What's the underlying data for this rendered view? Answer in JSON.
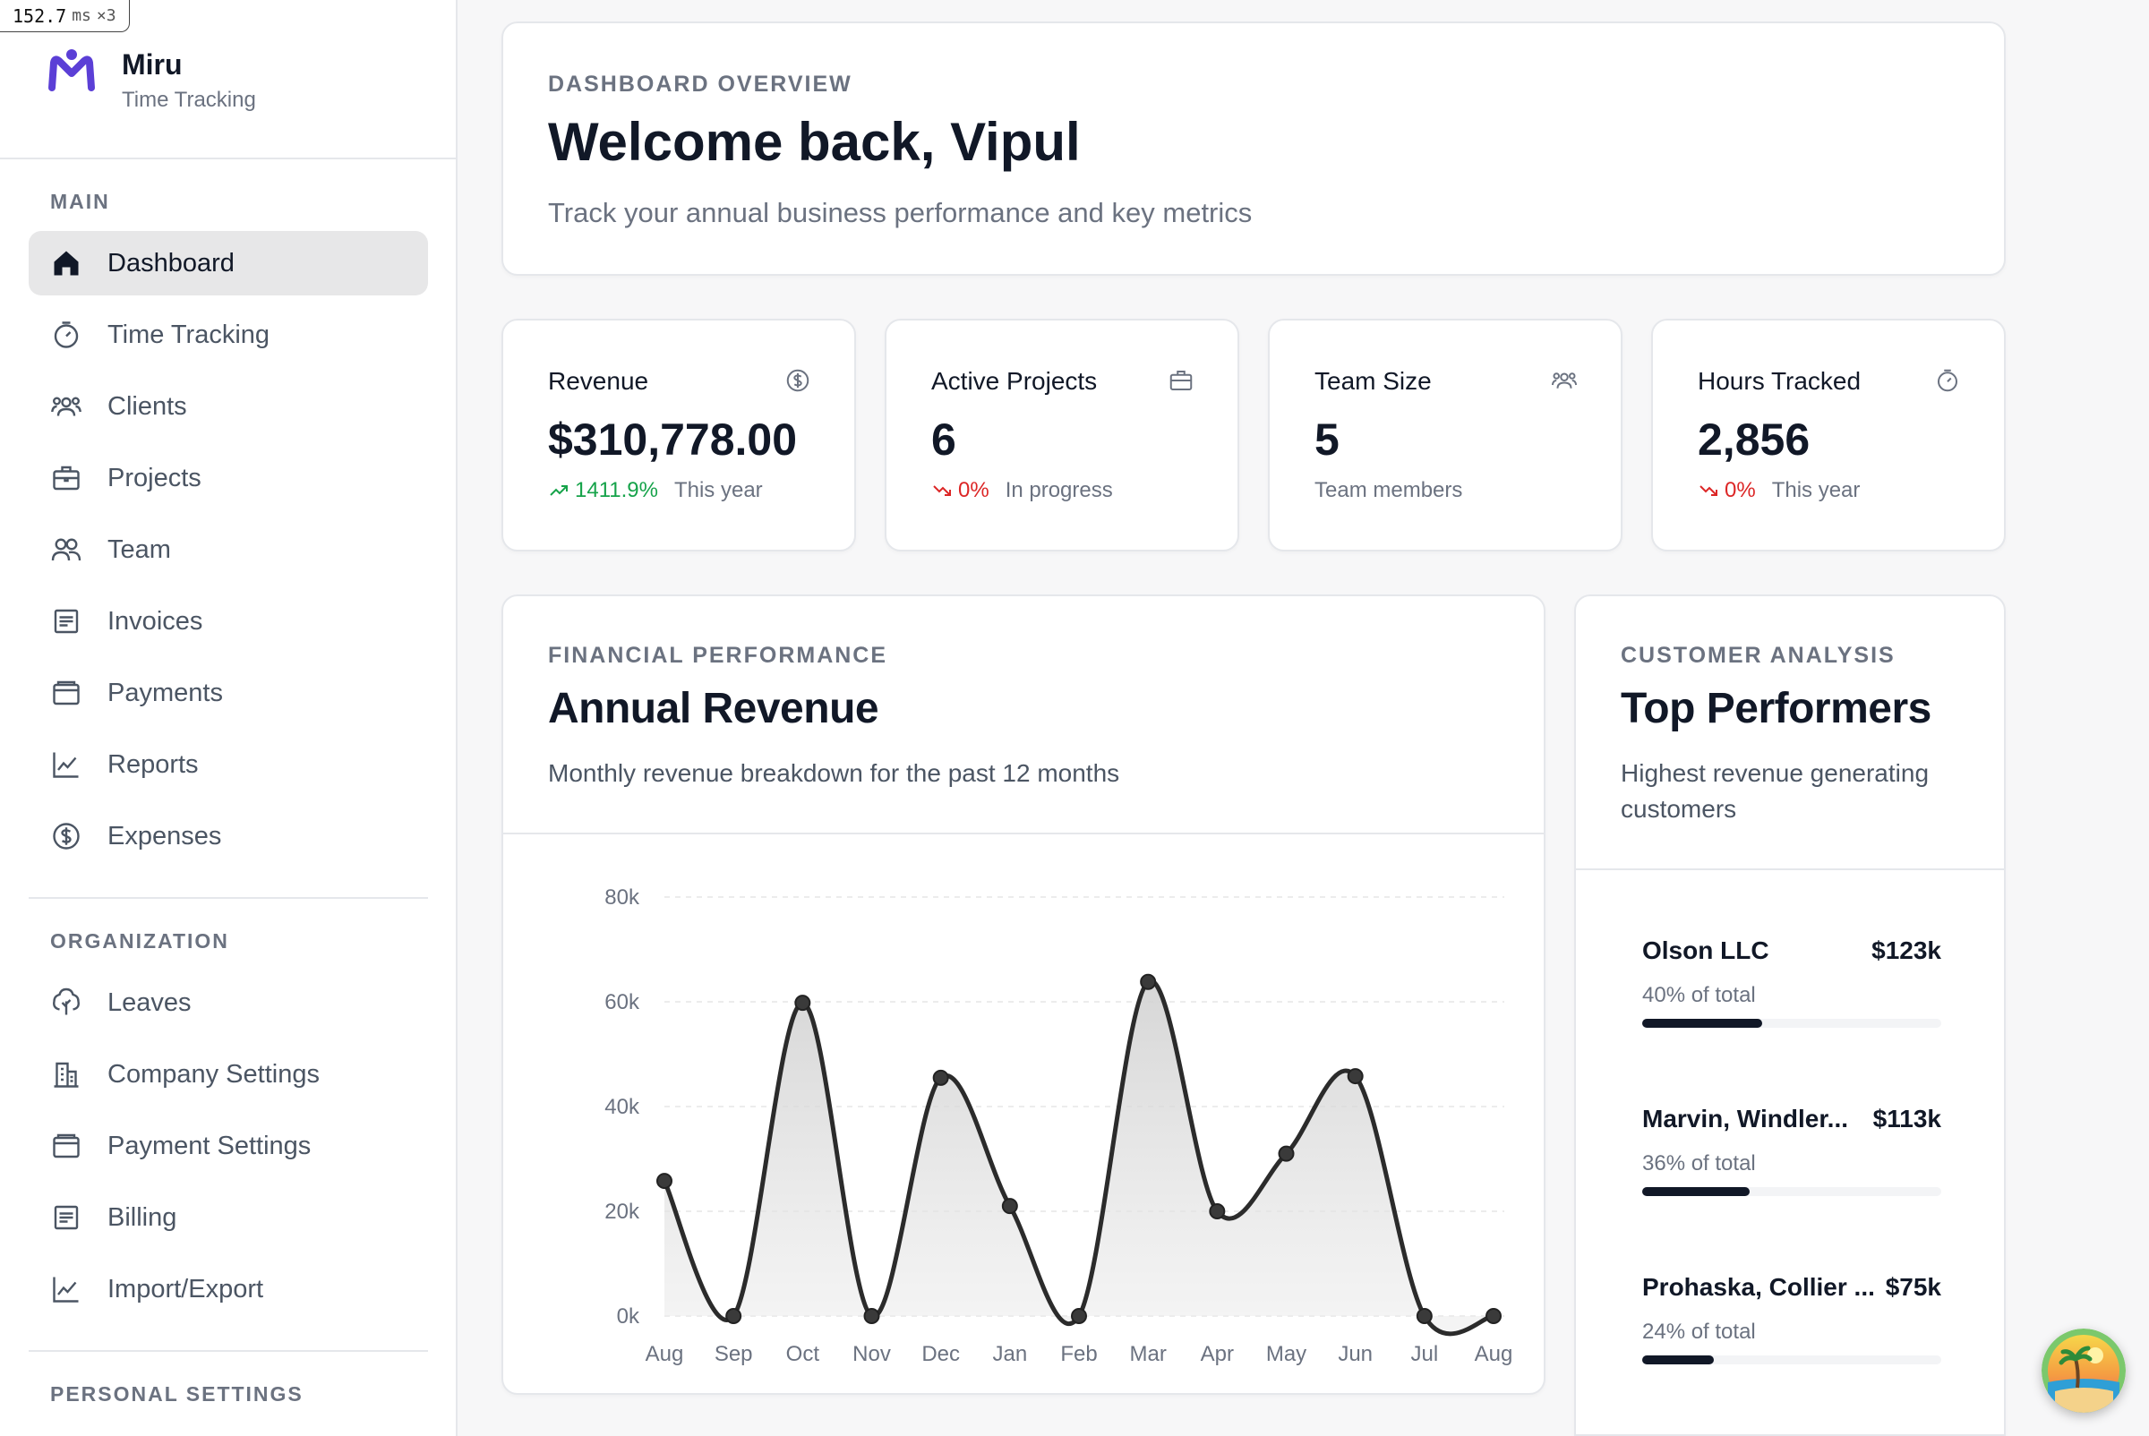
{
  "perf": {
    "value": "152.7",
    "unit": "ms",
    "count": "×3"
  },
  "brand": {
    "name": "Miru",
    "subtitle": "Time Tracking"
  },
  "sidebar": {
    "main_label": "MAIN",
    "main_items": [
      {
        "label": "Dashboard",
        "icon": "home-icon",
        "active": true
      },
      {
        "label": "Time Tracking",
        "icon": "timer-icon"
      },
      {
        "label": "Clients",
        "icon": "users-icon"
      },
      {
        "label": "Projects",
        "icon": "briefcase-icon"
      },
      {
        "label": "Team",
        "icon": "team-icon"
      },
      {
        "label": "Invoices",
        "icon": "invoice-icon"
      },
      {
        "label": "Payments",
        "icon": "wallet-icon"
      },
      {
        "label": "Reports",
        "icon": "chart-icon"
      },
      {
        "label": "Expenses",
        "icon": "dollar-circle-icon"
      }
    ],
    "org_label": "ORGANIZATION",
    "org_items": [
      {
        "label": "Leaves",
        "icon": "tree-icon"
      },
      {
        "label": "Company Settings",
        "icon": "building-icon"
      },
      {
        "label": "Payment Settings",
        "icon": "wallet-icon"
      },
      {
        "label": "Billing",
        "icon": "invoice-icon"
      },
      {
        "label": "Import/Export",
        "icon": "chart-icon"
      }
    ],
    "personal_label": "PERSONAL SETTINGS"
  },
  "welcome": {
    "eyebrow": "DASHBOARD OVERVIEW",
    "title": "Welcome back, Vipul",
    "subtitle": "Track your annual business performance and key metrics"
  },
  "stats": [
    {
      "title": "Revenue",
      "value": "$310,778.00",
      "change": "1411.9%",
      "trend": "up",
      "note": "This year",
      "icon": "dollar-circle-icon"
    },
    {
      "title": "Active Projects",
      "value": "6",
      "change": "0%",
      "trend": "down",
      "note": "In progress",
      "icon": "briefcase-icon"
    },
    {
      "title": "Team Size",
      "value": "5",
      "change": "",
      "trend": "",
      "note": "Team members",
      "icon": "users-icon"
    },
    {
      "title": "Hours Tracked",
      "value": "2,856",
      "change": "0%",
      "trend": "down",
      "note": "This year",
      "icon": "timer-icon"
    }
  ],
  "revenue_panel": {
    "eyebrow": "FINANCIAL PERFORMANCE",
    "title": "Annual Revenue",
    "description": "Monthly revenue breakdown for the past 12 months"
  },
  "chart_data": {
    "type": "area",
    "categories": [
      "Aug",
      "Sep",
      "Oct",
      "Nov",
      "Dec",
      "Jan",
      "Feb",
      "Mar",
      "Apr",
      "May",
      "Jun",
      "Jul",
      "Aug"
    ],
    "values": [
      25800,
      0,
      59800,
      0,
      45500,
      21000,
      0,
      63800,
      20000,
      31000,
      45800,
      0,
      0
    ],
    "y_ticks": [
      "0k",
      "20k",
      "40k",
      "60k",
      "80k"
    ],
    "ylim": [
      0,
      80000
    ],
    "grid": true,
    "line_color": "#2b2b2b",
    "fill_color": "#d4d4d4"
  },
  "performers_panel": {
    "eyebrow": "CUSTOMER ANALYSIS",
    "title": "Top Performers",
    "description": "Highest revenue generating customers",
    "items": [
      {
        "name": "Olson LLC",
        "amount": "$123k",
        "pct_label": "40% of total",
        "share": 0.4
      },
      {
        "name": "Marvin, Windler...",
        "amount": "$113k",
        "pct_label": "36% of total",
        "share": 0.36
      },
      {
        "name": "Prohaska, Collier ...",
        "amount": "$75k",
        "pct_label": "24% of total",
        "share": 0.24
      }
    ]
  },
  "colors": {
    "accent": "#5b3fd6",
    "up": "#16a34a",
    "down": "#dc2626"
  }
}
